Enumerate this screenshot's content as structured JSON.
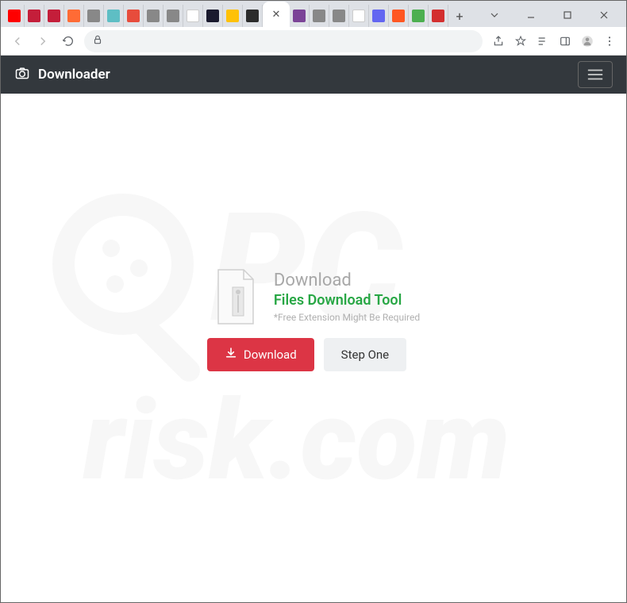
{
  "window": {
    "controls": {
      "dropdown": "⌄",
      "minimize": "—",
      "maximize": "☐",
      "close": "✕"
    }
  },
  "tabs": {
    "new_tab": "+",
    "active_close": "✕"
  },
  "addressbar": {
    "url": ""
  },
  "navbar": {
    "brand": "Downloader"
  },
  "content": {
    "heading": "Download",
    "subheading": "Files Download Tool",
    "note": "*Free Extension Might Be Required",
    "download_button": "Download",
    "step_button": "Step One"
  },
  "watermark": {
    "line1": "PC",
    "line2": "risk.com"
  }
}
